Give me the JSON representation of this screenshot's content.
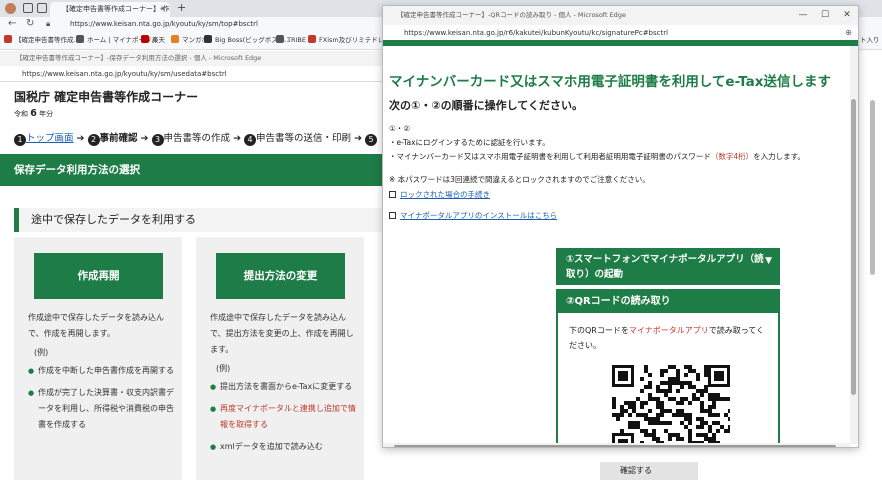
{
  "main_browser": {
    "tab_title": "【確定申告書等作成コーナー】-作成コ",
    "url": "https://www.keisan.nta.go.jp/kyoutu/ky/sm/top#bsctrl",
    "bookmarks": [
      {
        "label": "【確定申告書等作成...",
        "color": "#c0392b"
      },
      {
        "label": "ホーム | マイナポータル",
        "color": "#555555"
      },
      {
        "label": "楽天",
        "color": "#bf0000"
      },
      {
        "label": "マンガボ",
        "color": "#e67e22"
      },
      {
        "label": "Big Boss(ビッグボス) -...",
        "color": "#333333"
      },
      {
        "label": "TRIBE",
        "color": "#555555"
      },
      {
        "label": "FXism及びリミテドレ...",
        "color": "#c0392b"
      }
    ],
    "bookmarks_overflow": "ト入り"
  },
  "window1": {
    "title": "【確定申告書等作成コーナー】-保存データ利用方法の選択 - 個人 - Microsoft Edge",
    "url": "https://www.keisan.nta.go.jp/kyoutu/ky/sm/usedata#bsctrl",
    "site_title": "国税庁 確定申告書等作成コーナー",
    "era": "令和",
    "year": "6",
    "year_suffix": "年分",
    "steps": [
      {
        "num": "1",
        "label": "トップ画面"
      },
      {
        "num": "2",
        "label": "事前確認"
      },
      {
        "num": "3",
        "label": "申告書等の作成"
      },
      {
        "num": "4",
        "label": "申告書等の送信・印刷"
      },
      {
        "num": "5",
        "label": ""
      }
    ],
    "section_bar": "保存データ利用方法の選択",
    "section_heading": "途中で保存したデータを利用する",
    "card_left": {
      "button": "作成再開",
      "desc": "作成途中で保存したデータを読み込んで、作成を再開します。",
      "example": "(例)",
      "items": [
        "作成を中断した申告書作成を再開する",
        "作成が完了した決算書・収支内訳書データを利用し、所得税や消費税の申告書を作成する"
      ]
    },
    "card_right": {
      "button": "提出方法の変更",
      "desc": "作成途中で保存したデータを読み込んで、提出方法を変更の上、作成を再開します。",
      "example": "(例)",
      "items": [
        "提出方法を書面からe-Taxに変更する",
        "再度マイナポータルと連携し追加で情報を取得する",
        "xmlデータを追加で読み込む"
      ]
    },
    "confirm_button": "確認する"
  },
  "popup": {
    "title": "【確定申告書等作成コーナー】-QRコードの読み取り - 個人 - Microsoft Edge",
    "url": "https://www.keisan.nta.go.jp/r6/kakutei/kubunKyoutu/kc/signaturePc#bsctrl",
    "heading": "マイナンバーカード又はスマホ用電子証明書を利用してe-Tax送信します",
    "subheading": "次の①・②の順番に操作してください。",
    "line1": "①・②",
    "line2": "・e-Taxにログインするために認証を行います。",
    "line3_a": "・マイナンバーカード又はスマホ用電子証明書を利用して利用者証明用電子証明書のパスワード",
    "line3_red": "（数字4桁）",
    "line3_b": "を入力します。",
    "note": "※ 本パスワードは3回連続で間違えるとロックされますのでご注意ください。",
    "link1": "ロックされた場合の手続き",
    "link2": "マイナポータルアプリのインストールはこちら",
    "step1_label": "①スマートフォンでマイナポータルアプリ（読取り）の起動",
    "step2_label": "②QRコードの読み取り",
    "step2_desc_a": "下のQRコードを",
    "step2_desc_red": "マイナポータルアプリ",
    "step2_desc_b": "で読み取ってください。"
  }
}
